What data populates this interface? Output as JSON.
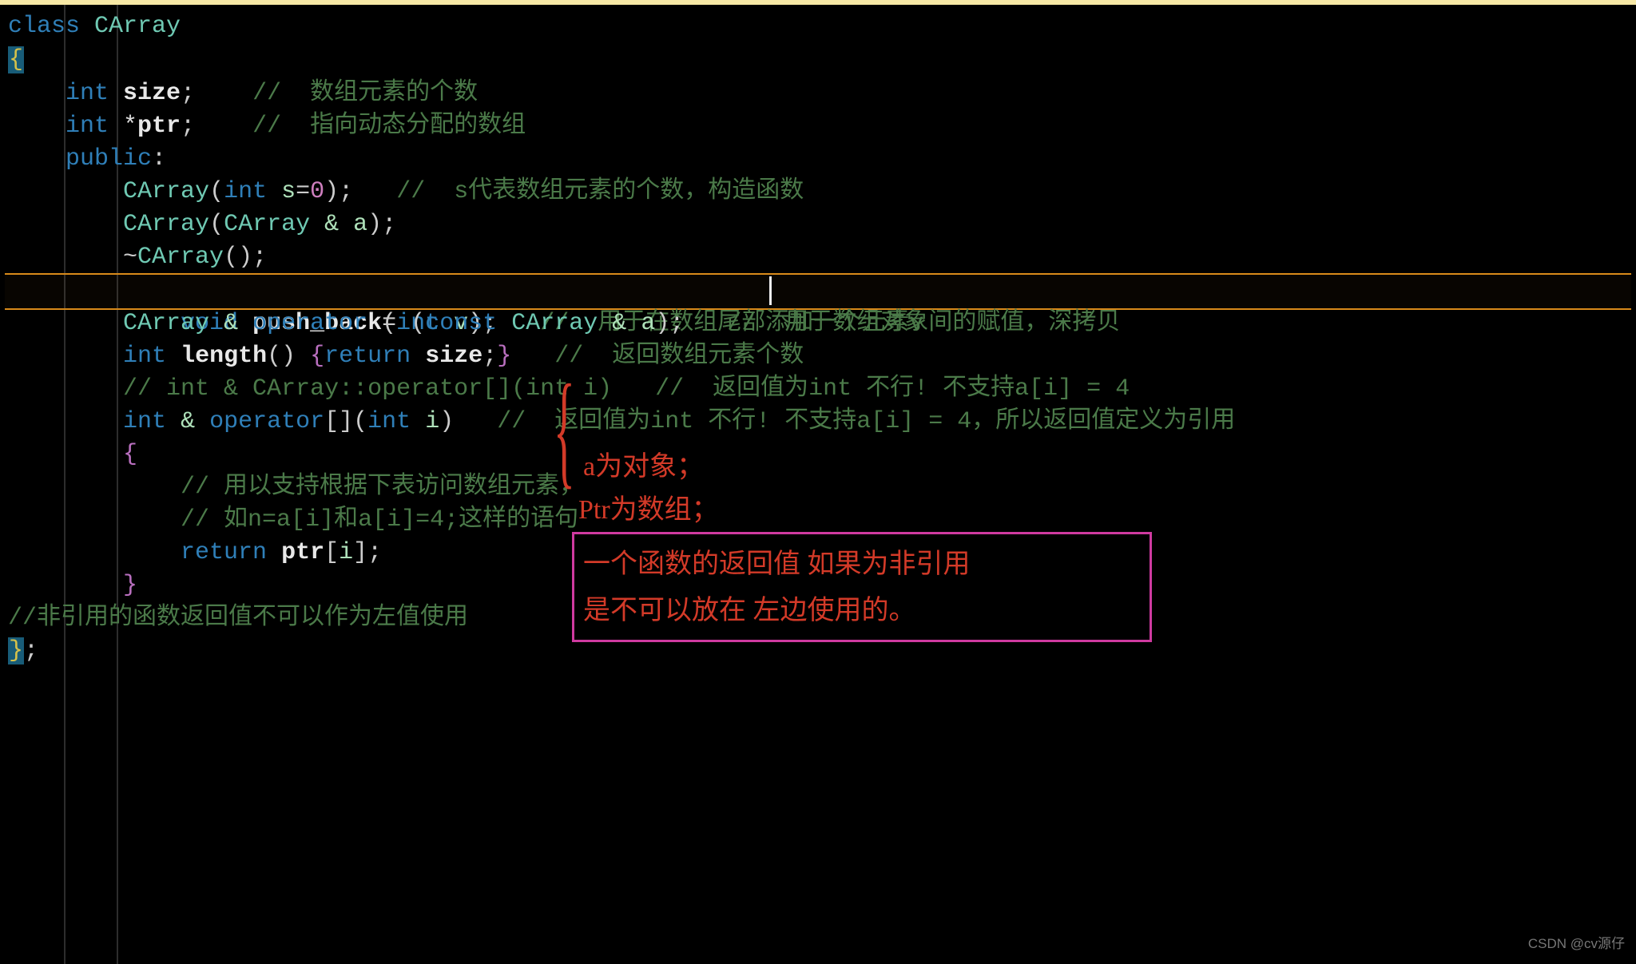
{
  "code": {
    "l1": {
      "kw": "class",
      "sp": " ",
      "type": "CArray"
    },
    "l2": {
      "brace": "{"
    },
    "l3": {
      "indent": "    ",
      "kw": "int",
      "sp": " ",
      "name": "size",
      "semi": ";",
      "gap": "    ",
      "com": "//  数组元素的个数"
    },
    "l4": {
      "indent": "    ",
      "kw": "int",
      "sp": " *",
      "name": "ptr",
      "semi": ";",
      "gap": "    ",
      "com": "//  指向动态分配的数组"
    },
    "l5": {
      "indent": "    ",
      "kw": "public",
      "colon": ":"
    },
    "l6": {
      "indent": "        ",
      "type": "CArray",
      "open": "(",
      "kw": "int",
      "sp": " ",
      "param": "s",
      "eq": "=",
      "num": "0",
      "close": ")",
      "semi": ";",
      "gap": "   ",
      "com": "//  s代表数组元素的个数，构造函数"
    },
    "l7": {
      "indent": "        ",
      "type": "CArray",
      "open": "(",
      "type2": "CArray",
      "sp": " ",
      "amp": "&",
      "sp2": " ",
      "param": "a",
      "close": ")",
      "semi": ";"
    },
    "l8": {
      "indent": "        ",
      "tilde": "~",
      "type": "CArray",
      "open": "(",
      ")": "",
      "close": ")",
      "semi": ";"
    },
    "l9": {
      "indent": "        ",
      "kw": "void",
      "sp": " ",
      "name": "push_back",
      "open": "(",
      "kw2": "int",
      "sp2": " ",
      "param": "v",
      "close": ")",
      "semi": ";",
      "gap": "   ",
      "com": "//  用于在数组尾部添加一个元素v"
    },
    "l10": {
      "indent": "        ",
      "type": "CArray",
      "sp": " ",
      "amp": "&",
      "sp2": " ",
      "opkw": "operator",
      "sp3": " ",
      "eq": "=",
      "sp4": " ",
      "open": "(",
      "kw": "const",
      "sp5": " ",
      "type2": "CArray",
      "sp6": " ",
      "amp2": "&",
      "sp7": " ",
      "param": "a",
      "close": ")",
      "semi": ";",
      "gap": "   ",
      "com": "//  用于数组对象间的赋值，深拷贝"
    },
    "l11": {
      "indent": "        ",
      "kw": "int",
      "sp": " ",
      "name": "length",
      "open": "(",
      ")": "",
      "close": ")",
      "sp2": " ",
      "brace": "{",
      "kw2": "return",
      "sp3": " ",
      "name2": "size",
      "semi": ";",
      "brace2": "}",
      "gap": "   ",
      "com": "//  返回数组元素个数"
    },
    "l12": {
      "indent": "        ",
      "com": "// int & CArray::operator[](int i)   //  返回值为int 不行! 不支持a[i] = 4"
    },
    "l13": {
      "indent": "        ",
      "kw": "int",
      "sp": " ",
      "amp": "&",
      "sp2": " ",
      "opkw": "operator",
      "br": "[]",
      "open": "(",
      "kw2": "int",
      "sp3": " ",
      "param": "i",
      "close": ")",
      "gap": "   ",
      "com": "//  返回值为int 不行! 不支持a[i] = 4，所以返回值定义为引用"
    },
    "l14": {
      "indent": "        ",
      "brace": "{"
    },
    "l15": {
      "indent": "            ",
      "com": "// 用以支持根据下表访问数组元素，"
    },
    "l16": {
      "indent": "            ",
      "com": "// 如n=a[i]和a[i]=4;这样的语句"
    },
    "l17": {
      "indent": "            ",
      "kw": "return",
      "sp": " ",
      "name": "ptr",
      "open": "[",
      "param": "i",
      "close": "]",
      "semi": ";"
    },
    "l18": {
      "indent": "        ",
      "brace": "}"
    },
    "l19": {
      "com": "//非引用的函数返回值不可以作为左值使用"
    },
    "l20": {
      "brace": "}",
      "semi": ";"
    }
  },
  "annotations": {
    "n1": "a为对象；",
    "n2": "Ptr为数组；",
    "n3": "一个函数的返回值 如果为非引用",
    "n4": "是不可以放在 左边使用的。"
  },
  "watermark": "CSDN @cv源仔"
}
